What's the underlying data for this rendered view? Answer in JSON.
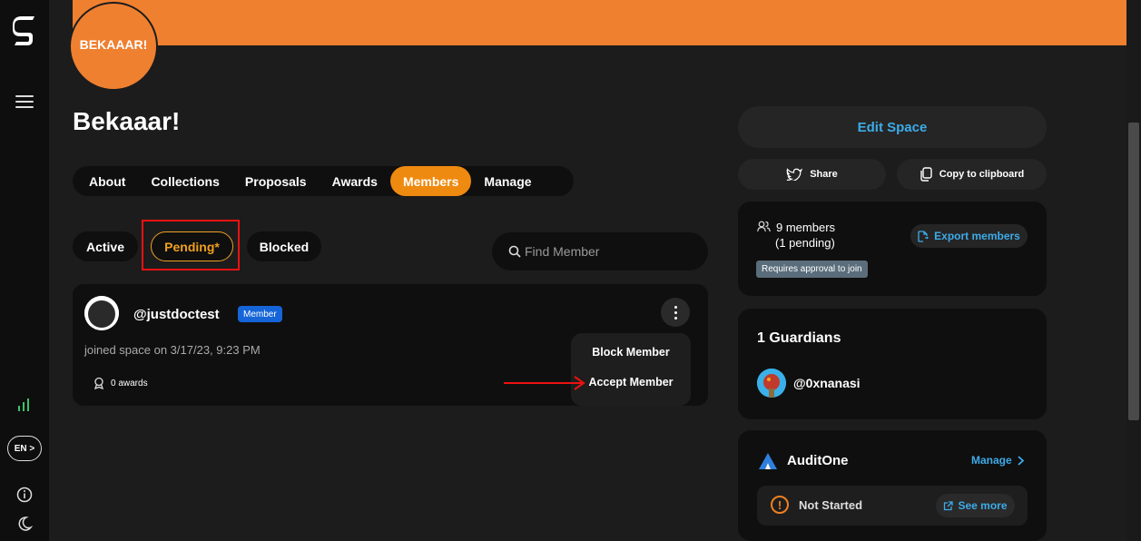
{
  "sidebar": {
    "logo_icon": "sharkdao-logo-icon",
    "menu_icon": "hamburger-icon",
    "stats_icon": "bar-chart-icon",
    "language": "EN >",
    "info_icon": "info-icon",
    "theme_icon": "moon-icon"
  },
  "space": {
    "avatar_text": "BEKAAAR!",
    "name": "Bekaaar!",
    "banner_color": "#ef8030"
  },
  "tabs": [
    {
      "label": "About",
      "active": false
    },
    {
      "label": "Collections",
      "active": false
    },
    {
      "label": "Proposals",
      "active": false
    },
    {
      "label": "Awards",
      "active": false
    },
    {
      "label": "Members",
      "active": true
    },
    {
      "label": "Manage",
      "active": false
    }
  ],
  "filters": {
    "active": "Active",
    "pending": "Pending*",
    "blocked": "Blocked"
  },
  "search": {
    "placeholder": "Find Member"
  },
  "member": {
    "handle": "@justdoctest",
    "badge": "Member",
    "joined": "joined space on 3/17/23, 9:23 PM",
    "awards": "0 awards"
  },
  "context_menu": {
    "block": "Block Member",
    "accept": "Accept Member"
  },
  "right": {
    "edit_space": "Edit Space",
    "share": "Share",
    "copy": "Copy to clipboard",
    "members_count": "9 members",
    "members_pending": "(1 pending)",
    "requires_approval": "Requires approval to join",
    "export": "Export members",
    "guardians_title": "1 Guardians",
    "guardian_handle": "@0xnanasi",
    "audit_title": "AuditOne",
    "audit_manage": "Manage",
    "audit_status": "Not Started",
    "audit_see_more": "See more"
  },
  "colors": {
    "accent_orange": "#ef8a10",
    "link_blue": "#3dabe8",
    "annotation_red": "#e11111"
  }
}
